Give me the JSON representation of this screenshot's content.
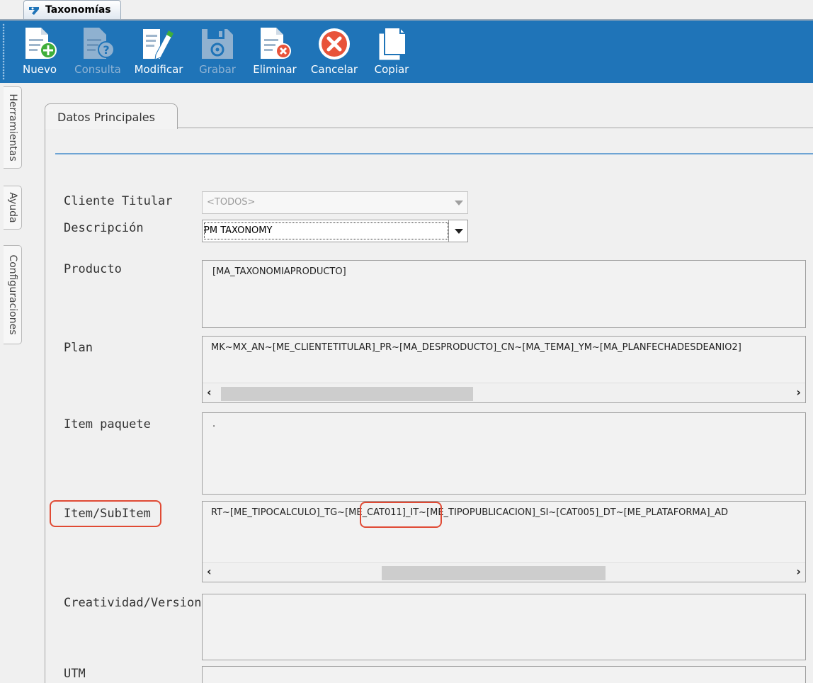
{
  "window_tab": {
    "title": "Taxonomías"
  },
  "toolbar": {
    "buttons": [
      {
        "label": "Nuevo",
        "icon": "new-document-icon",
        "enabled": true
      },
      {
        "label": "Consulta",
        "icon": "query-document-icon",
        "enabled": false
      },
      {
        "label": "Modificar",
        "icon": "edit-document-icon",
        "enabled": true
      },
      {
        "label": "Grabar",
        "icon": "save-disk-icon",
        "enabled": false
      },
      {
        "label": "Eliminar",
        "icon": "delete-document-icon",
        "enabled": true
      },
      {
        "label": "Cancelar",
        "icon": "cancel-icon",
        "enabled": true
      },
      {
        "label": "Copiar",
        "icon": "copy-icon",
        "enabled": true
      }
    ]
  },
  "side_tabs": [
    "Herramientas",
    "Ayuda",
    "Configuraciones"
  ],
  "panel": {
    "tab": "Datos Principales",
    "fields": {
      "cliente_titular": {
        "label": "Cliente Titular",
        "value": "<TODOS>",
        "enabled": false
      },
      "descripcion": {
        "label": "Descripción",
        "value": "PM TAXONOMY"
      },
      "producto": {
        "label": "Producto",
        "value": "[MA_TAXONOMIAPRODUCTO]"
      },
      "plan": {
        "label": "Plan",
        "value": "MK~MX_AN~[ME_CLIENTETITULAR]_PR~[MA_DESPRODUCTO]_CN~[MA_TEMA]_YM~[MA_PLANFECHADESDEANIO2]"
      },
      "item_paquete": {
        "label": "Item paquete",
        "value": "."
      },
      "item_subitem": {
        "label": "Item/SubItem",
        "value_parts": [
          "RT~[ME_TIPOCALCULO]_TG~",
          "[ME_CAT011]",
          "_IT~[ME_TIPOPUBLICACION]_SI~[CAT005]_DT~[ME_PLATAFORMA]_AD"
        ]
      },
      "creatividad": {
        "label": "Creatividad/Version",
        "value": ""
      },
      "utm": {
        "label": "UTM",
        "value": ""
      }
    }
  },
  "colors": {
    "toolbar_bg": "#1f74b8",
    "highlight": "#e04a34",
    "panel_line": "#6ea4d4"
  }
}
